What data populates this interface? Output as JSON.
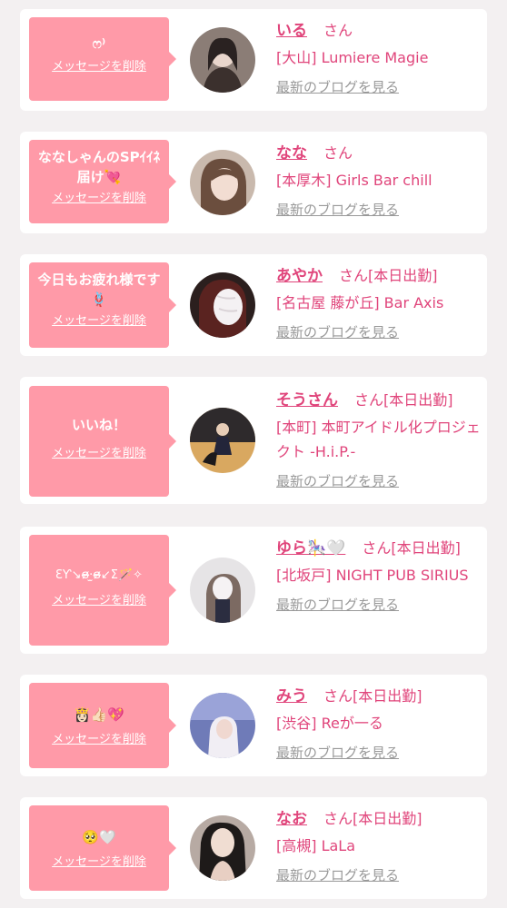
{
  "accent_color": "#ff9aa8",
  "name_color": "#e0457b",
  "entries": [
    {
      "message": "ෆ⁾",
      "delete_label": "メッセージを削除",
      "name": "いる",
      "honorific": "さん",
      "today": "",
      "shop": "[大山] Lumiere Magie",
      "blog_label": "最新のブログを見る",
      "avatar_icon": "avatar-photo-icon"
    },
    {
      "message": "ななしゃんのSPｲｲﾈ届け💘",
      "delete_label": "メッセージを削除",
      "name": "なな",
      "honorific": "さん",
      "today": "",
      "shop": "[本厚木] Girls Bar chill",
      "blog_label": "最新のブログを見る",
      "avatar_icon": "avatar-photo-icon"
    },
    {
      "message": "今日もお疲れ様です🪢",
      "delete_label": "メッセージを削除",
      "name": "あやか",
      "honorific": "さん",
      "today": "[本日出勤]",
      "shop": "[名古屋 藤が丘] Bar Axis",
      "blog_label": "最新のブログを見る",
      "avatar_icon": "avatar-photo-icon"
    },
    {
      "message": "いいね！",
      "delete_label": "メッセージを削除",
      "name": "そうさん",
      "honorific": "さん",
      "today": "[本日出勤]",
      "shop": "[本町] 本町アイドル化プロジェクト -H.i.P.-",
      "blog_label": "最新のブログを見る",
      "avatar_icon": "avatar-photo-icon"
    },
    {
      "message": "ƐƳ↘︎ɞ̴̶̷·̫ɞ̴̶̷↙︎Ʃ🪄✧",
      "delete_label": "メッセージを削除",
      "name": "ゆら🎠🤍",
      "honorific": "さん",
      "today": "[本日出勤]",
      "shop": "[北坂戸] NIGHT PUB SIRIUS",
      "blog_label": "最新のブログを見る",
      "avatar_icon": "avatar-photo-icon"
    },
    {
      "message": "👸🏻👍🏻💖",
      "delete_label": "メッセージを削除",
      "name": "みう",
      "honorific": "さん",
      "today": "[本日出勤]",
      "shop": "[渋谷] Reが一る",
      "blog_label": "最新のブログを見る",
      "avatar_icon": "avatar-photo-icon"
    },
    {
      "message": "🥺🤍",
      "delete_label": "メッセージを削除",
      "name": "なお",
      "honorific": "さん",
      "today": "[本日出勤]",
      "shop": "[高槻] LaLa",
      "blog_label": "最新のブログを見る",
      "avatar_icon": "avatar-photo-icon"
    }
  ]
}
